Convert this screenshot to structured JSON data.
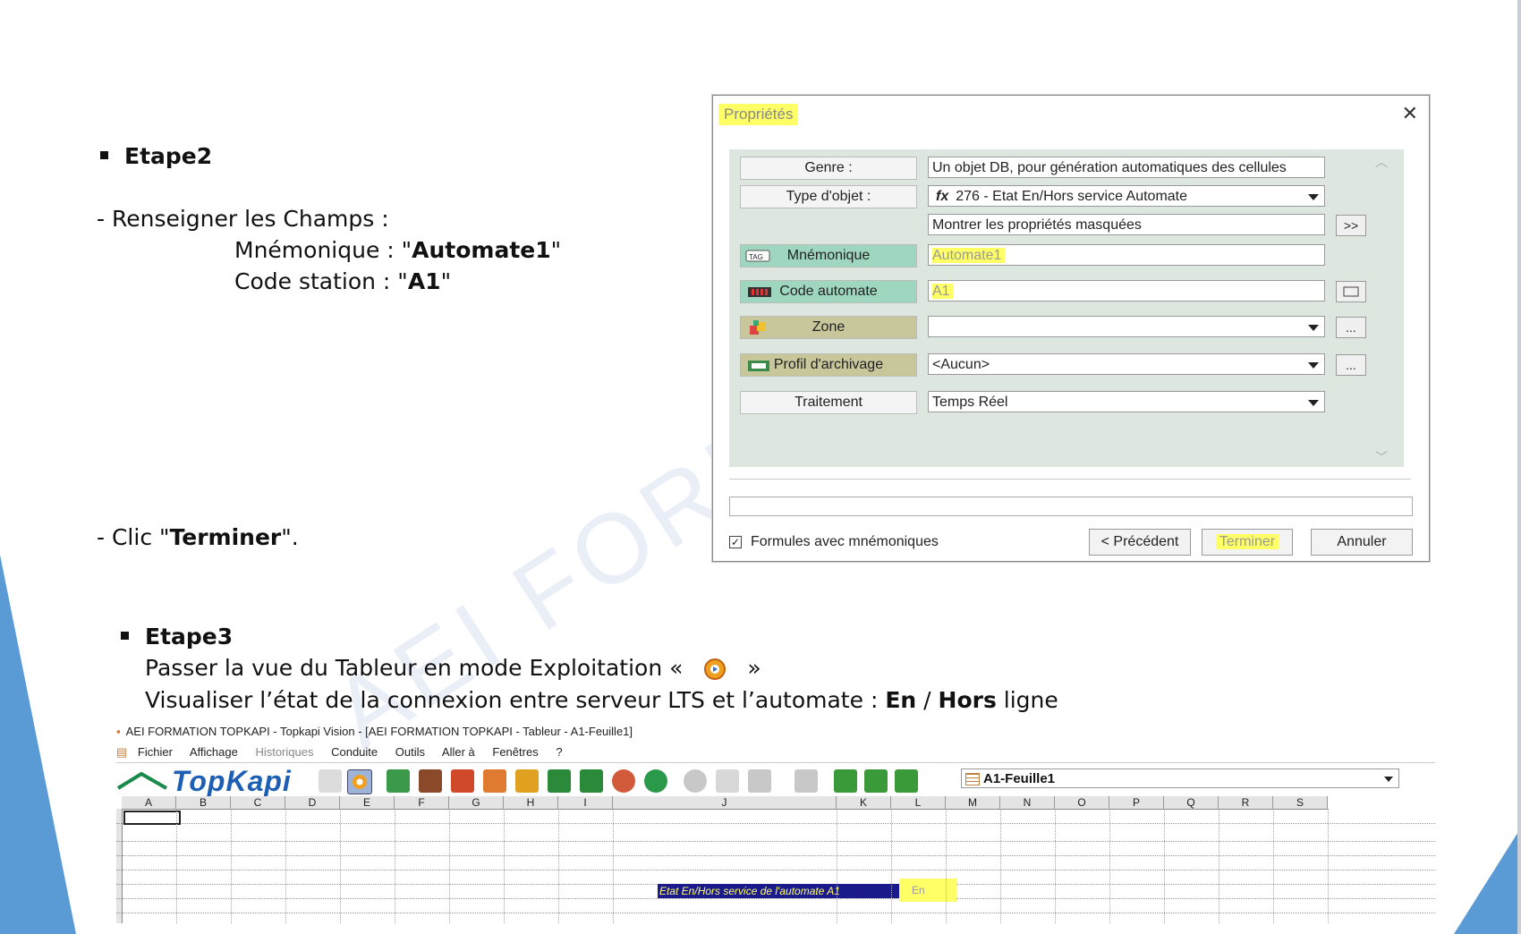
{
  "slide": {
    "etape2": "Etape2",
    "renseigner": "- Renseigner les Champs :",
    "mnemo_prefix": "Mnémonique : \"",
    "mnemo_value": "Automate1",
    "mnemo_suffix": "\"",
    "code_prefix": "Code station   : \"",
    "code_value": "A1",
    "code_suffix": "\"",
    "clic_prefix": "- Clic \"",
    "clic_value": "Terminer",
    "clic_suffix": "\".",
    "etape3": "Etape3",
    "passer_prefix": "Passer la vue du Tableur en mode Exploitation «",
    "passer_suffix": "»",
    "visualiser_prefix": "Visualiser l’état de la connexion entre serveur LTS et l’automate : ",
    "visualiser_en": "En",
    "visualiser_slash": " / ",
    "visualiser_hors": "Hors",
    "visualiser_suffix": " ligne",
    "watermark": "AEI FORMA"
  },
  "dialog": {
    "title": "Propriétés",
    "close": "✕",
    "rows": {
      "genre_label": "Genre :",
      "genre_value": "Un objet DB, pour génération automatiques des cellules",
      "type_label": "Type d'objet :",
      "type_value": "276 - Etat En/Hors service Automate",
      "type_fx": "fx",
      "masquees_value": "Montrer les propriétés masquées",
      "masquees_btn": ">>",
      "mnemo_label": "Mnémonique",
      "mnemo_value": "Automate1",
      "code_label": "Code automate",
      "code_value": "A1",
      "zone_label": "Zone",
      "zone_value": "",
      "zone_btn": "...",
      "profil_label": "Profil d'archivage",
      "profil_value": "<Aucun>",
      "profil_btn": "...",
      "traitement_label": "Traitement",
      "traitement_value": "Temps Réel"
    },
    "checkbox_label": "Formules avec mnémoniques",
    "checkbox_checked": "✓",
    "btn_prev": "< Précédent",
    "btn_finish": "Terminer",
    "btn_cancel": "Annuler",
    "highlight_color": "#ffff66"
  },
  "topkapi": {
    "title": "AEI FORMATION TOPKAPI - Topkapi Vision - [AEI FORMATION TOPKAPI - Tableur - A1-Feuille1]",
    "menu": [
      "Fichier",
      "Affichage",
      "Historiques",
      "Conduite",
      "Outils",
      "Aller à",
      "Fenêtres",
      "?"
    ],
    "logo": "TopKapi",
    "sheet": "A1-Feuille1",
    "columns": [
      "A",
      "B",
      "C",
      "D",
      "E",
      "F",
      "G",
      "H",
      "I",
      "J",
      "K",
      "L",
      "M",
      "N",
      "O",
      "P",
      "Q",
      "R",
      "S"
    ],
    "cell_label": "Etat En/Hors service de l'automate A1",
    "cell_value": "En"
  }
}
